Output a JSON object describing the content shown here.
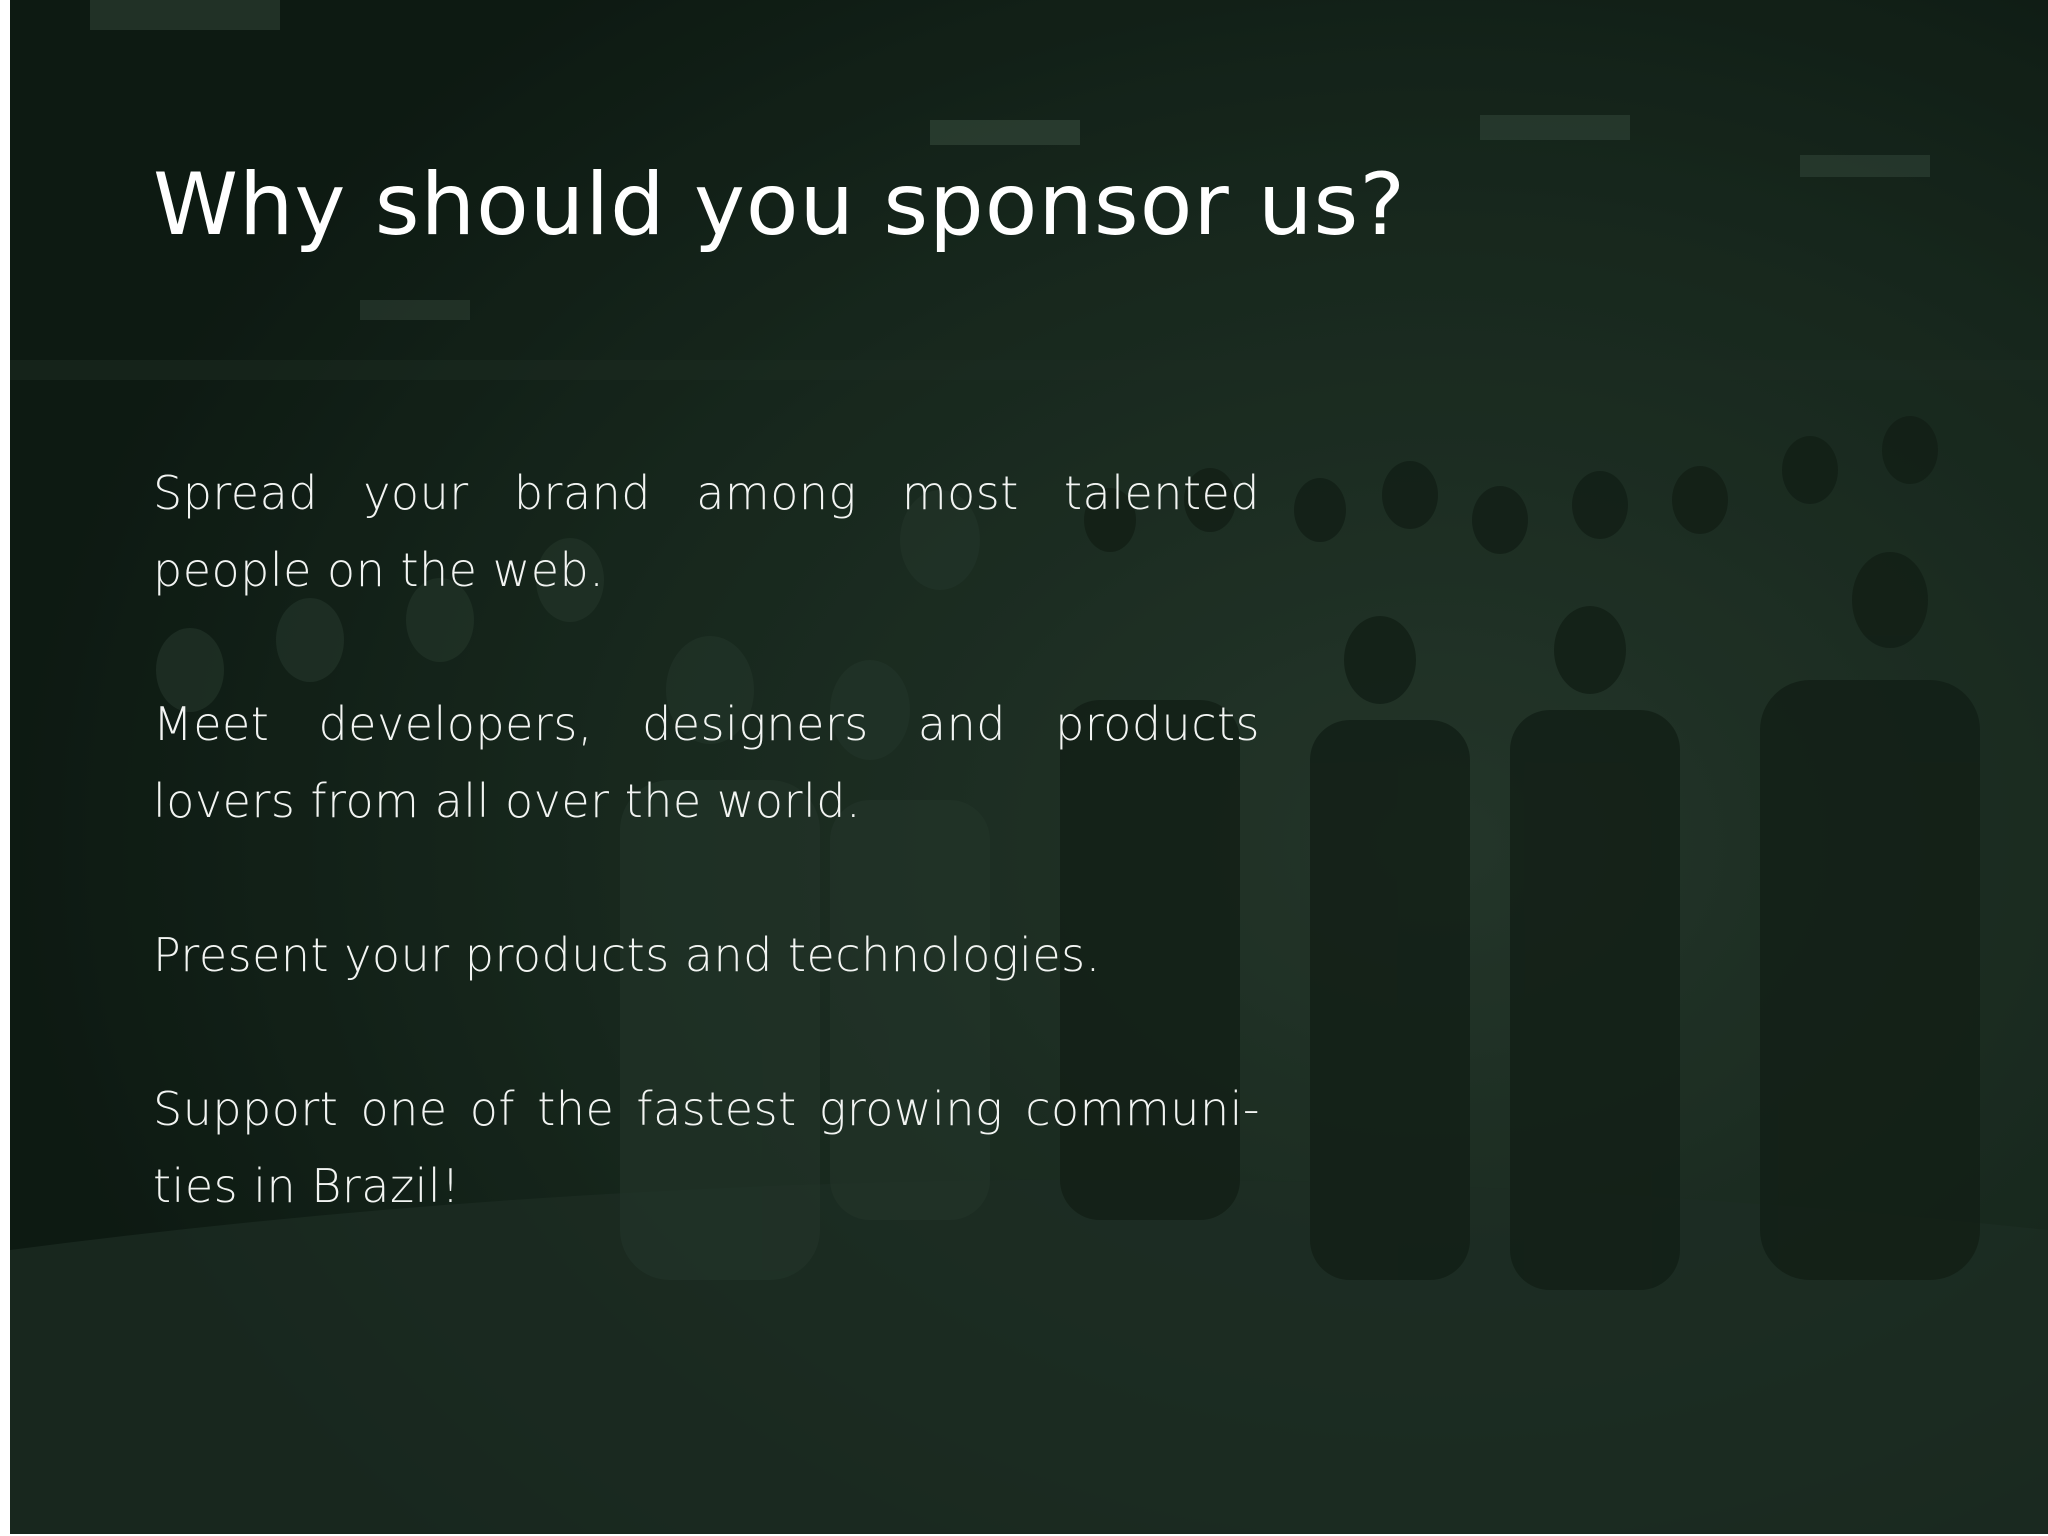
{
  "slide": {
    "title": "Why should you sponsor us?",
    "points": [
      "Spread your brand among most talented people on the web.",
      "Meet developers, designers and products lovers from all over the world.",
      "Present your products and technologies.",
      "Support one of the fastest growing communi-ties in Brazil!"
    ]
  },
  "colors": {
    "background_tint": "#1a281e",
    "text": "#ffffff"
  }
}
